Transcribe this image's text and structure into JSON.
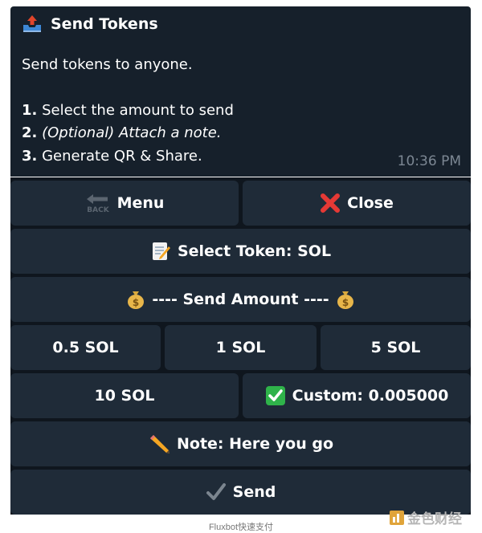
{
  "message": {
    "title": "Send Tokens",
    "intro": "Send tokens to anyone.",
    "steps": [
      {
        "num": "1.",
        "text": "Select the amount to send"
      },
      {
        "num": "2.",
        "text": "(Optional) Attach a note."
      },
      {
        "num": "3.",
        "text": "Generate QR & Share."
      }
    ],
    "time": "10:36 PM"
  },
  "keyboard": {
    "menu_back_glyph": "BACK",
    "menu": "Menu",
    "close": "Close",
    "select_token": "Select Token: SOL",
    "send_amount": "---- Send Amount ----",
    "amounts": [
      "0.5 SOL",
      "1 SOL",
      "5 SOL",
      "10 SOL"
    ],
    "custom": "Custom: 0.005000",
    "note": "Note: Here you go",
    "send": "Send"
  },
  "caption": "Fluxbot快速支付",
  "watermark": "金色财经",
  "icons": {
    "title": "outbox-tray-icon",
    "menu": "back-arrow-icon",
    "close": "red-x-icon",
    "select_token": "memo-icon",
    "send_amount": "money-bag-icon",
    "custom": "check-box-icon",
    "note": "pencil-icon",
    "send": "check-mark-icon"
  },
  "colors": {
    "message_bg": "#16202b",
    "button_bg": "#1f2b38",
    "keyboard_bg": "#0f161e",
    "timestamp": "#7c8793",
    "close_red": "#e53935",
    "check_green": "#2fb34a"
  }
}
